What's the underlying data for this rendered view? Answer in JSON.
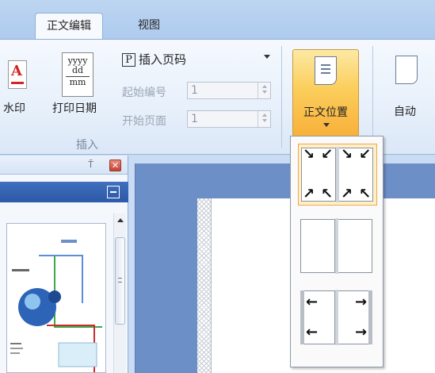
{
  "tabs": [
    {
      "label": "正文编辑",
      "active": true
    },
    {
      "label": "视图",
      "active": false
    }
  ],
  "ribbon": {
    "watermark_label": "水印",
    "print_date_label": "打印日期",
    "print_date_icon": {
      "line1": "yyyy",
      "line2": "dd",
      "line3": "mm"
    },
    "insert_page_number_label": "插入页码",
    "start_number_label": "起始编号",
    "start_number_value": "1",
    "start_page_label": "开始页面",
    "start_page_value": "1",
    "insert_group_label": "插入",
    "body_position_label": "正文位置",
    "auto_label": "自动"
  },
  "left_pane": {
    "pin_icon": "pin-icon",
    "close_icon": "close-icon"
  },
  "position_dropdown": {
    "options": [
      {
        "name": "corners-inward",
        "selected": true
      },
      {
        "name": "blank",
        "selected": false
      },
      {
        "name": "sides-inward",
        "selected": false
      }
    ]
  },
  "colors": {
    "accent": "#f8b13a",
    "selection_border": "#f0a64a",
    "pane_bar": "#2c59a8",
    "doc_background": "#6d8fc7"
  }
}
